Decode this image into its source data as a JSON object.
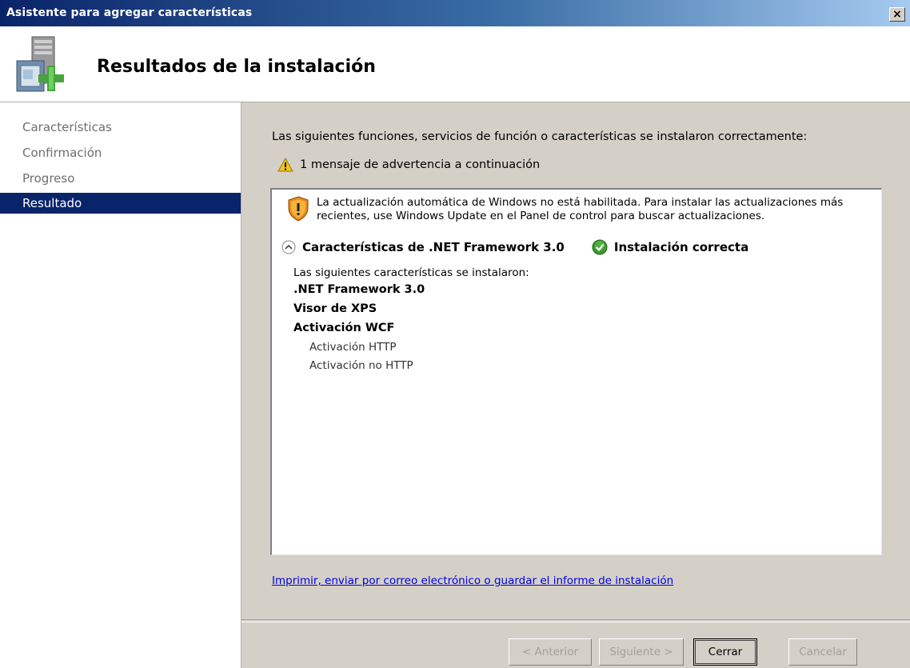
{
  "window": {
    "title": "Asistente para agregar características",
    "close_label": "×"
  },
  "header": {
    "title": "Resultados de la instalación",
    "icon": "server-add-icon"
  },
  "sidebar": {
    "steps": [
      {
        "label": "Características",
        "active": false
      },
      {
        "label": "Confirmación",
        "active": false
      },
      {
        "label": "Progreso",
        "active": false
      },
      {
        "label": "Resultado",
        "active": true
      }
    ]
  },
  "main": {
    "intro": "Las siguientes funciones, servicios de función o características se instalaron correctamente:",
    "warning_summary": "1 mensaje de advertencia a continuación",
    "update_message": "La actualización automática de Windows no está habilitada. Para instalar las actualizaciones más recientes, use Windows Update en el Panel de control para buscar actualizaciones.",
    "feature_group": {
      "name": "Características de .NET Framework 3.0",
      "status": "Instalación correcta",
      "installed_label": "Las siguientes características se instalaron:",
      "items": [
        {
          "label": ".NET Framework 3.0",
          "level": 0
        },
        {
          "label": "Visor de XPS",
          "level": 0
        },
        {
          "label": "Activación WCF",
          "level": 0
        },
        {
          "label": "Activación HTTP",
          "level": 1
        },
        {
          "label": "Activación no HTTP",
          "level": 1
        }
      ]
    },
    "report_link": "Imprimir, enviar por correo electrónico o guardar el informe de instalación"
  },
  "buttons": {
    "back": "< Anterior",
    "next": "Siguiente >",
    "close": "Cerrar",
    "cancel": "Cancelar"
  },
  "colors": {
    "title_bar": "#0a246a",
    "selected_step": "#0a246a",
    "link": "#0000e0",
    "success": "#3c9a2e",
    "warning": "#f0c419"
  }
}
